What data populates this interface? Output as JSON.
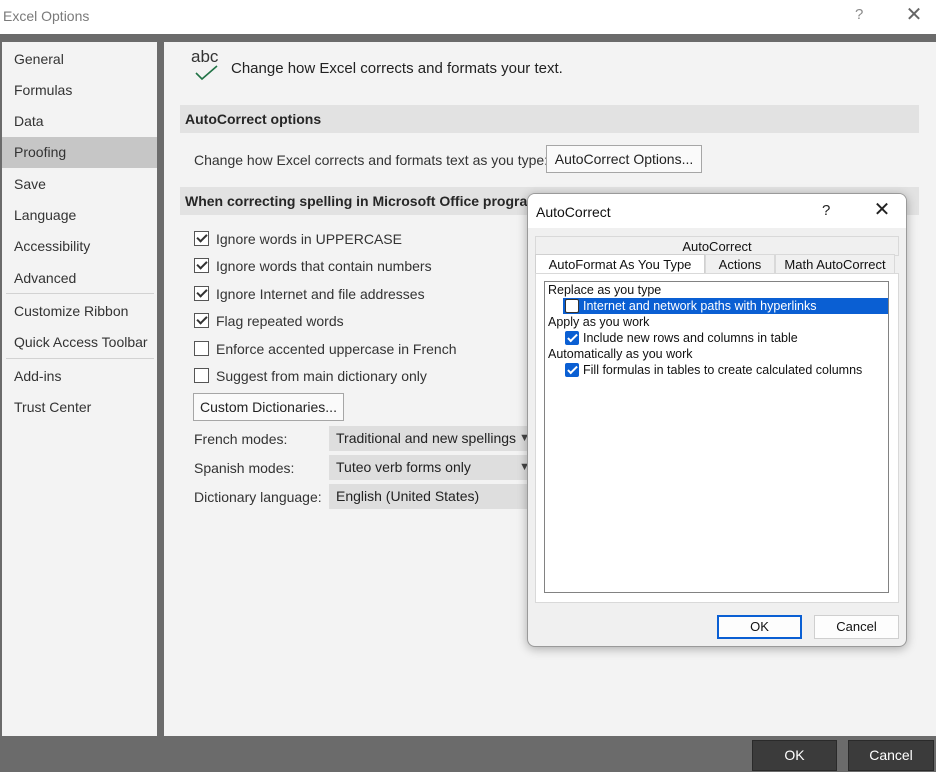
{
  "window": {
    "title": "Excel Options",
    "help": "?",
    "close": "✕"
  },
  "sidebar": {
    "items": [
      {
        "label": "General"
      },
      {
        "label": "Formulas"
      },
      {
        "label": "Data"
      },
      {
        "label": "Proofing",
        "active": true
      },
      {
        "label": "Save"
      },
      {
        "label": "Language"
      },
      {
        "label": "Accessibility"
      },
      {
        "label": "Advanced"
      },
      {
        "label": "Customize Ribbon"
      },
      {
        "label": "Quick Access Toolbar"
      },
      {
        "label": "Add-ins"
      },
      {
        "label": "Trust Center"
      }
    ]
  },
  "main": {
    "icon_text": "abc",
    "header": "Change how Excel corrects and formats your text.",
    "autocorrect_section": "AutoCorrect options",
    "autocorrect_label": "Change how Excel corrects and formats text as you type:",
    "autocorrect_button": "AutoCorrect Options...",
    "spelling_section": "When correcting spelling in Microsoft Office programs",
    "checkboxes": [
      {
        "label": "Ignore words in UPPERCASE",
        "checked": true
      },
      {
        "label": "Ignore words that contain numbers",
        "checked": true
      },
      {
        "label": "Ignore Internet and file addresses",
        "checked": true
      },
      {
        "label": "Flag repeated words",
        "checked": true
      },
      {
        "label": "Enforce accented uppercase in French",
        "checked": false
      },
      {
        "label": "Suggest from main dictionary only",
        "checked": false
      }
    ],
    "custom_dict_button": "Custom Dictionaries...",
    "french_label": "French modes:",
    "french_value": "Traditional and new spellings",
    "spanish_label": "Spanish modes:",
    "spanish_value": "Tuteo verb forms only",
    "dict_lang_label": "Dictionary language:",
    "dict_lang_value": "English (United States)"
  },
  "footer": {
    "ok": "OK",
    "cancel": "Cancel"
  },
  "dialog": {
    "title": "AutoCorrect",
    "help": "?",
    "close": "✕",
    "tabs": {
      "top": "AutoCorrect",
      "autoformat": "AutoFormat As You Type",
      "actions": "Actions",
      "math": "Math AutoCorrect"
    },
    "groups": {
      "replace": "Replace as you type",
      "apply": "Apply as you work",
      "auto": "Automatically as you work"
    },
    "options": {
      "internet": {
        "label": "Internet and network paths with hyperlinks",
        "checked": false,
        "selected": true
      },
      "rows": {
        "label": "Include new rows and columns in table",
        "checked": true
      },
      "formulas": {
        "label": "Fill formulas in tables to create calculated columns",
        "checked": true
      }
    },
    "ok": "OK",
    "cancel": "Cancel"
  },
  "colors": {
    "accent": "#0a5fd3",
    "sidebar_active": "#c6c6c6",
    "footer_bg": "#6b6b6b"
  }
}
